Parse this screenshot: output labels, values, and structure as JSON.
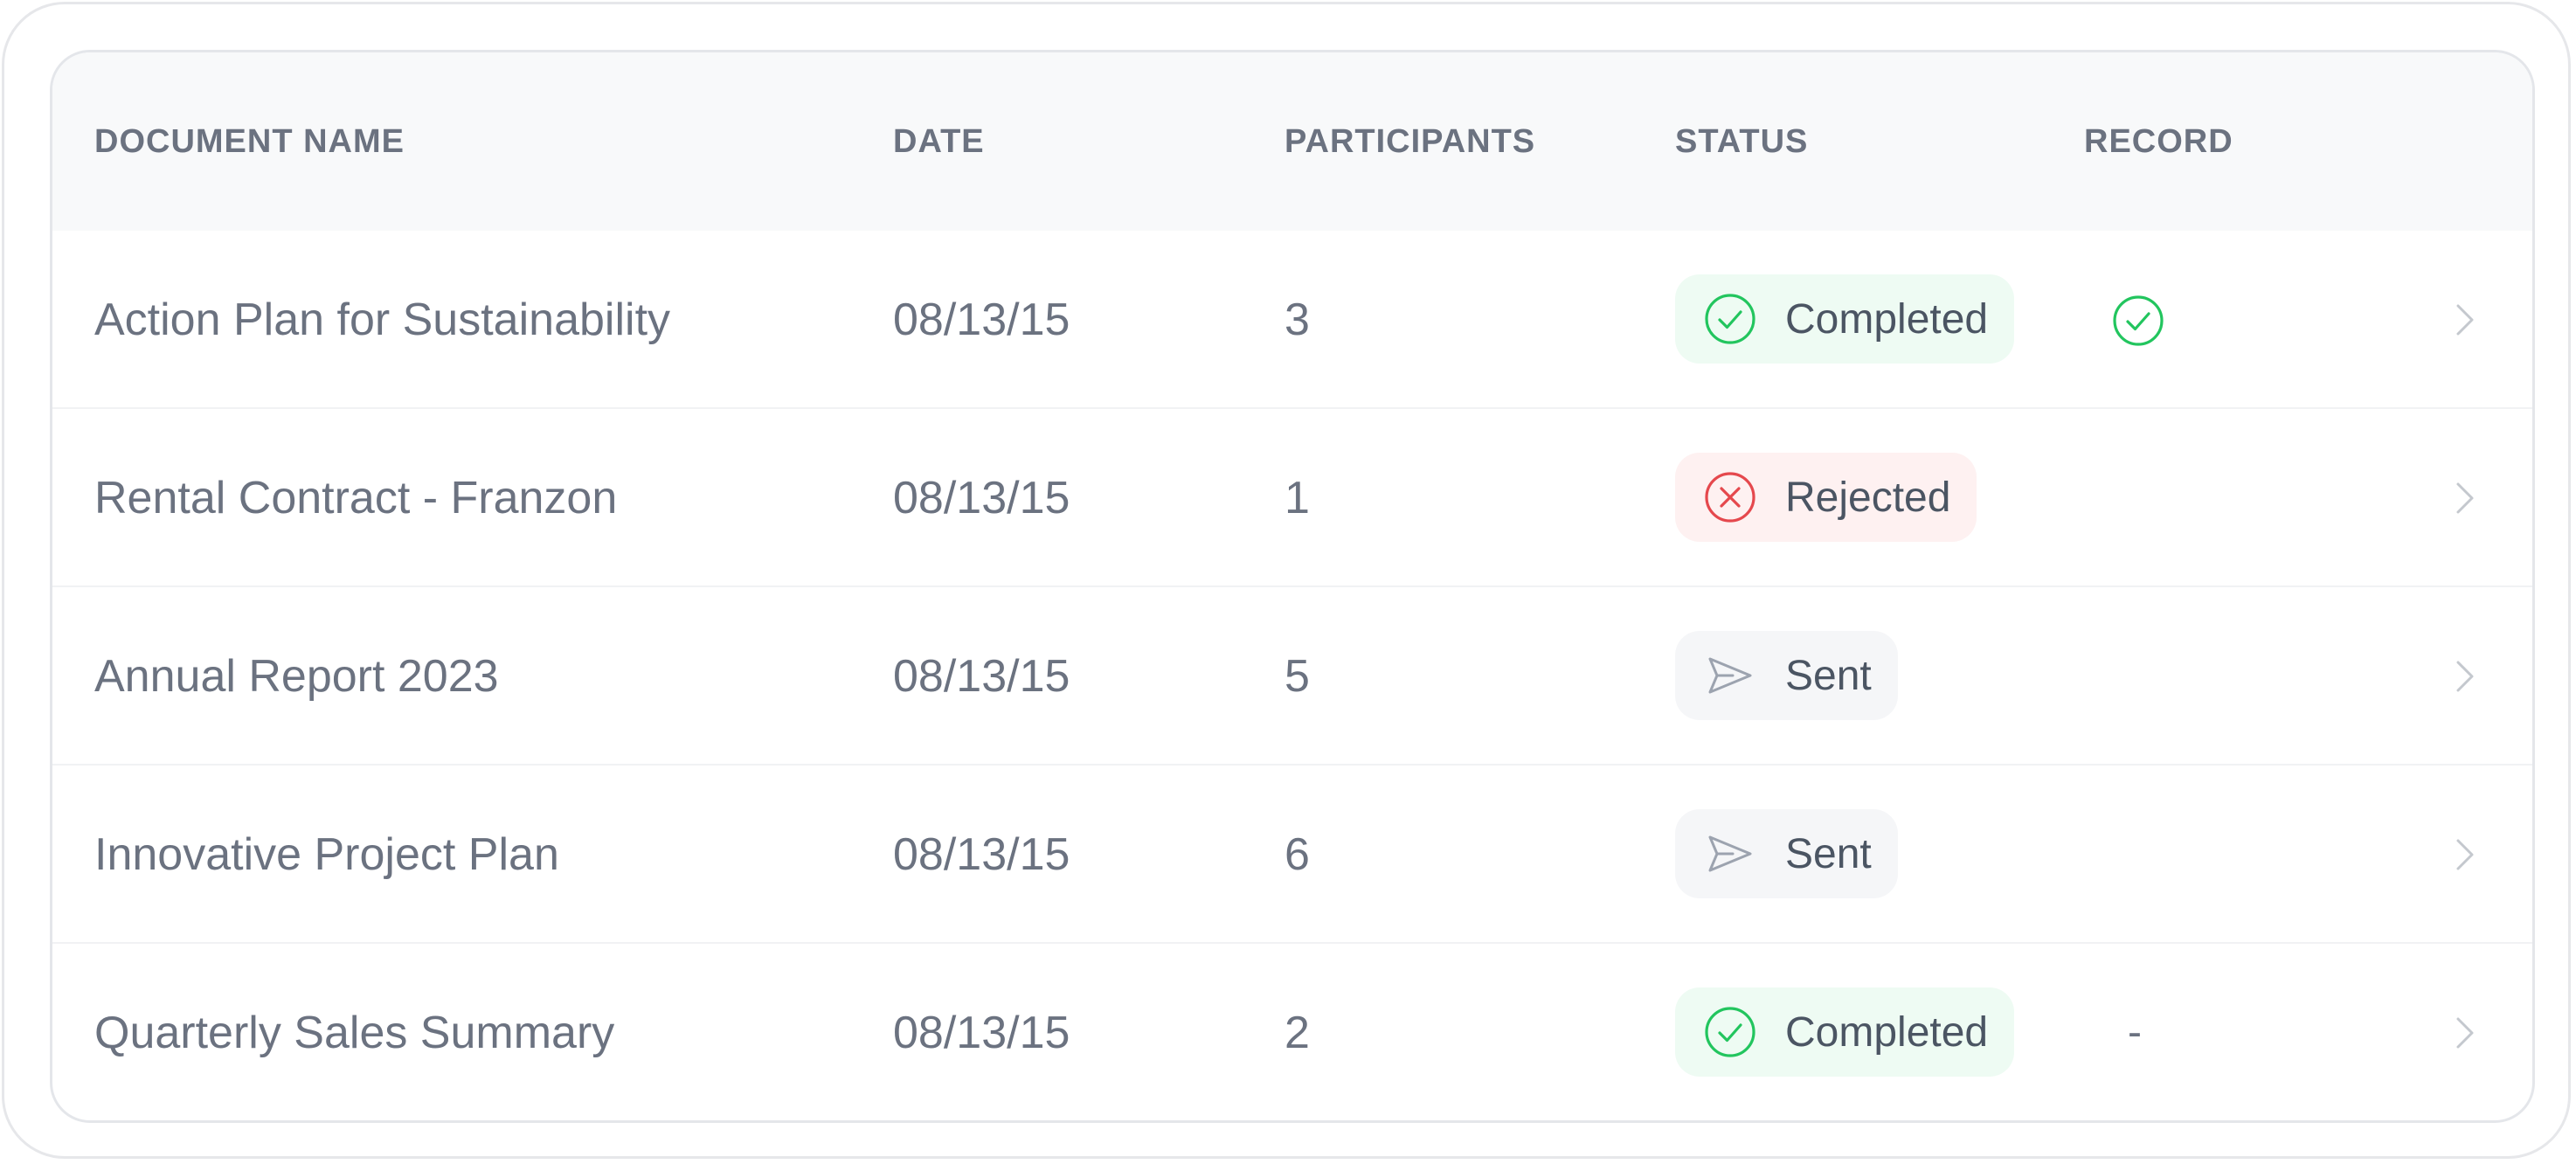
{
  "table": {
    "headers": [
      "DOCUMENT NAME",
      "DATE",
      "PARTICIPANTS",
      "STATUS",
      "RECORD"
    ],
    "rows": [
      {
        "name": "Action Plan for Sustainability",
        "date": "08/13/15",
        "participants": "3",
        "status": "Completed",
        "status_icon": "check-circle-icon",
        "record": "check-circle-icon"
      },
      {
        "name": "Rental Contract - Franzon",
        "date": "08/13/15",
        "participants": "1",
        "status": "Rejected",
        "status_icon": "x-circle-icon",
        "record": ""
      },
      {
        "name": "Annual Report 2023",
        "date": "08/13/15",
        "participants": "5",
        "status": "Sent",
        "status_icon": "send-icon",
        "record": ""
      },
      {
        "name": "Innovative Project Plan",
        "date": "08/13/15",
        "participants": "6",
        "status": "Sent",
        "status_icon": "send-icon",
        "record": ""
      },
      {
        "name": "Quarterly Sales Summary",
        "date": "08/13/15",
        "participants": "2",
        "status": "Completed",
        "status_icon": "check-circle-icon",
        "record": "-"
      }
    ]
  },
  "colors": {
    "completed": "#22c55e",
    "rejected": "#e5484d",
    "sent": "#9ca3af",
    "header_bg": "#f8f9fa",
    "text": "#6b7280"
  }
}
